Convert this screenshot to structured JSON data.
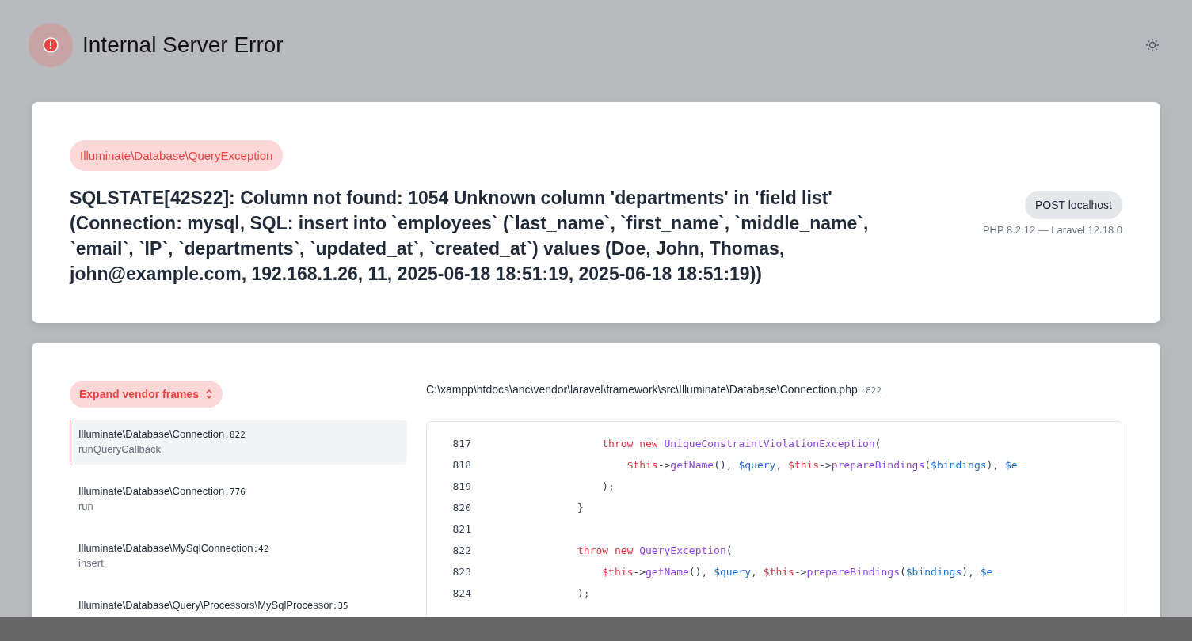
{
  "header": {
    "title": "Internal Server Error"
  },
  "exception": {
    "class": "Illuminate\\Database\\QueryException",
    "message": "SQLSTATE[42S22]: Column not found: 1054 Unknown column 'departments' in 'field list' (Connection: mysql, SQL: insert into `employees` (`last_name`, `first_name`, `middle_name`, `email`, `IP`, `departments`, `updated_at`, `created_at`) values (Doe, John, Thomas, john@example.com, 192.168.1.26, 11, 2025-06-18 18:51:19, 2025-06-18 18:51:19))",
    "request": "POST localhost",
    "versions": "PHP 8.2.12 — Laravel 12.18.0"
  },
  "trace": {
    "expand_button": "Expand vendor frames",
    "frames": [
      {
        "class": "Illuminate\\Database\\Connection",
        "line": ":822",
        "function": "runQueryCallback",
        "selected": true
      },
      {
        "class": "Illuminate\\Database\\Connection",
        "line": ":776",
        "function": "run",
        "selected": false
      },
      {
        "class": "Illuminate\\Database\\MySqlConnection",
        "line": ":42",
        "function": "insert",
        "selected": false
      },
      {
        "class": "Illuminate\\Database\\Query\\Processors\\MySqlProcessor",
        "line": ":35",
        "selected": false
      }
    ],
    "file": {
      "path": "C:\\xampp\\htdocs\\anc\\vendor\\laravel\\framework\\src\\Illuminate\\Database\\Connection.php",
      "line": ":822"
    },
    "code": [
      {
        "number": "817",
        "tokens": [
          {
            "kind": "keyword",
            "text": "                throw new "
          },
          {
            "kind": "class",
            "text": "UniqueConstraintViolationException"
          },
          {
            "kind": "plain",
            "text": "("
          }
        ]
      },
      {
        "number": "818",
        "tokens": [
          {
            "kind": "keyword",
            "text": "                    $this"
          },
          {
            "kind": "plain",
            "text": "->"
          },
          {
            "kind": "class",
            "text": "getName"
          },
          {
            "kind": "plain",
            "text": "(), "
          },
          {
            "kind": "variable",
            "text": "$query"
          },
          {
            "kind": "plain",
            "text": ", "
          },
          {
            "kind": "keyword",
            "text": "$this"
          },
          {
            "kind": "plain",
            "text": "->"
          },
          {
            "kind": "class",
            "text": "prepareBindings"
          },
          {
            "kind": "plain",
            "text": "("
          },
          {
            "kind": "variable",
            "text": "$bindings"
          },
          {
            "kind": "plain",
            "text": "), "
          },
          {
            "kind": "variable",
            "text": "$e"
          }
        ]
      },
      {
        "number": "819",
        "tokens": [
          {
            "kind": "plain",
            "text": "                );"
          }
        ]
      },
      {
        "number": "820",
        "tokens": [
          {
            "kind": "plain",
            "text": "            }"
          }
        ]
      },
      {
        "number": "821"
      },
      {
        "number": "822",
        "tokens": [
          {
            "kind": "keyword",
            "text": "            throw new "
          },
          {
            "kind": "class",
            "text": "QueryException"
          },
          {
            "kind": "plain",
            "text": "("
          }
        ]
      },
      {
        "number": "823",
        "tokens": [
          {
            "kind": "keyword",
            "text": "                $this"
          },
          {
            "kind": "plain",
            "text": "->"
          },
          {
            "kind": "class",
            "text": "getName"
          },
          {
            "kind": "plain",
            "text": "(), "
          },
          {
            "kind": "variable",
            "text": "$query"
          },
          {
            "kind": "plain",
            "text": ", "
          },
          {
            "kind": "keyword",
            "text": "$this"
          },
          {
            "kind": "plain",
            "text": "->"
          },
          {
            "kind": "class",
            "text": "prepareBindings"
          },
          {
            "kind": "plain",
            "text": "("
          },
          {
            "kind": "variable",
            "text": "$bindings"
          },
          {
            "kind": "plain",
            "text": "), "
          },
          {
            "kind": "variable",
            "text": "$e"
          }
        ]
      },
      {
        "number": "824",
        "tokens": [
          {
            "kind": "plain",
            "text": "            );"
          }
        ]
      }
    ]
  }
}
